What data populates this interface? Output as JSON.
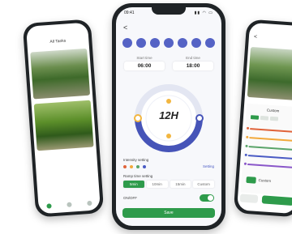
{
  "left_phone": {
    "header_title": "All Tanks",
    "nav_items": [
      "home",
      "settings",
      "profile"
    ]
  },
  "center_phone": {
    "status_time": "09:41",
    "status_icons": "▮▮ ◠ ▭",
    "back_symbol": "<",
    "days": [
      "",
      "",
      "",
      "",
      "",
      "",
      ""
    ],
    "start_label": "Start time",
    "start_value": "06:00",
    "end_label": "End time",
    "end_value": "18:00",
    "dial_label": "12H",
    "intensity_label": "Intensity setting",
    "intensity_dots": [
      "#e0633a",
      "#f2a93b",
      "#5aa469",
      "#4a5bc4"
    ],
    "setting_link": "Setting",
    "ramp_label": "Ramp time setting",
    "ramp_options": [
      "5min",
      "10min",
      "15min",
      "Custom"
    ],
    "ramp_active_index": 0,
    "toggle_label": "ON/OFF",
    "toggle_on": true,
    "save_label": "Save"
  },
  "right_phone": {
    "back_symbol": "<",
    "panel_title": "Custom",
    "button_label": "Custom",
    "slider_colors": [
      "#e0633a",
      "#f2a93b",
      "#5aa469",
      "#4a5bc4",
      "#8a57c9"
    ]
  },
  "colors": {
    "accent_green": "#2e9b4b",
    "accent_blue": "#4a5bc4",
    "dial_track": "#4654b8"
  }
}
